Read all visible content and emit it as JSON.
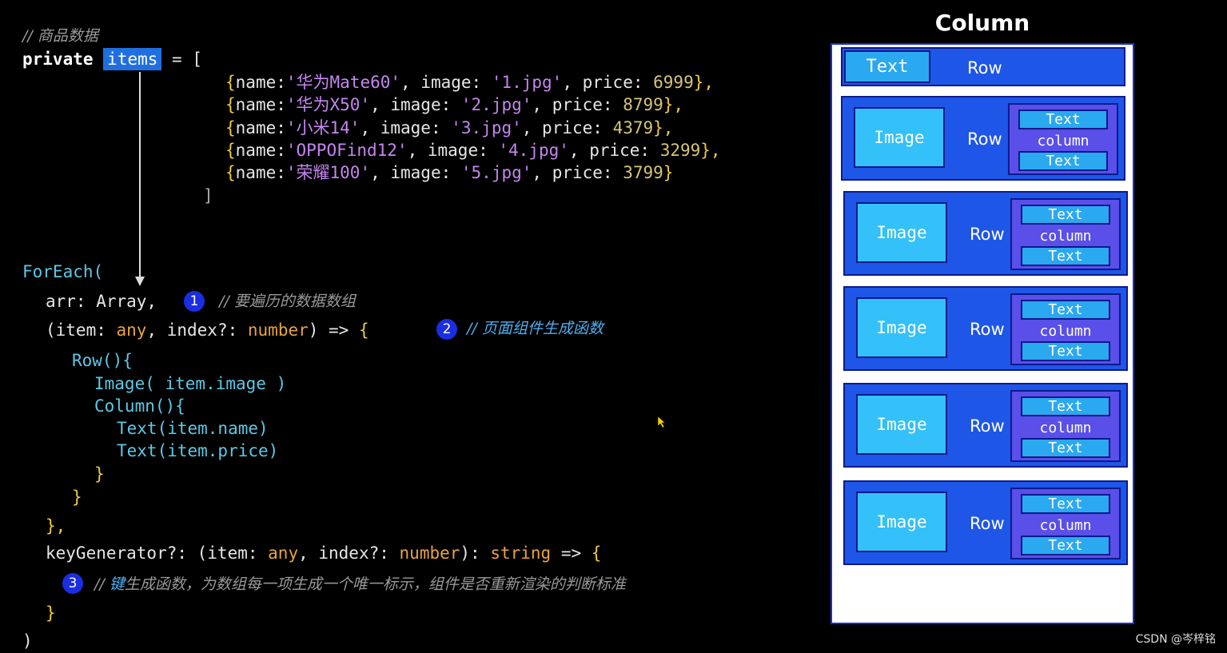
{
  "code": {
    "comment_top": "// 商品数据",
    "private_kw": "private",
    "items_name": "items",
    "assign": " = [",
    "entries": [
      {
        "name": "'华为Mate60'",
        "image": "'1.jpg'",
        "price": "6999",
        "end": "},"
      },
      {
        "name": "'华为X50'",
        "image": "'2.jpg'",
        "price": "8799",
        "end": "},"
      },
      {
        "name": "'小米14'",
        "image": "'3.jpg'",
        "price": "4379",
        "end": "},"
      },
      {
        "name": "'OPPOFind12'",
        "image": "'4.jpg'",
        "price": "3299",
        "end": "},"
      },
      {
        "name": "'荣耀100'",
        "image": "'5.jpg'",
        "price": "3799",
        "end": "}"
      }
    ],
    "close_bracket": "]",
    "foreach": "ForEach(",
    "arr_line": "arr: Array,",
    "arr_comment": "// 要遍历的数据数组",
    "item_line_a": "(item: ",
    "item_any": "any",
    "item_line_b": ", index?: ",
    "item_number": "number",
    "item_line_c": ") => ",
    "item_brace": "{",
    "item_comment": "// 页面组件生成函数",
    "row_open": "Row(){",
    "image_line": "Image( item.image )",
    "column_open": "Column(){",
    "text_name": "Text(item.name)",
    "text_price": "Text(item.price)",
    "close1": "}",
    "close2": "}",
    "close3": "},",
    "key_a": "keyGenerator?: (item: ",
    "key_any": "any",
    "key_b": ", index?: ",
    "key_number": "number",
    "key_c": "): ",
    "key_string": "string",
    "key_d": " => ",
    "key_brace": "{",
    "key_comment_hl": "键",
    "key_comment": "生成函数，为数组每一项生成一个唯一标示，组件是否重新渲染的判断标准",
    "key_comment_prefix": "// ",
    "close_key": "}",
    "close_paren": ")"
  },
  "badges": [
    "1",
    "2",
    "3"
  ],
  "diagram": {
    "title": "Column",
    "header_row": {
      "text": "Text",
      "row": "Row"
    },
    "rows": [
      {
        "image": "Image",
        "row": "Row",
        "col_top": "Text",
        "col_mid": "column",
        "col_bot": "Text"
      },
      {
        "image": "Image",
        "row": "Row",
        "col_top": "Text",
        "col_mid": "column",
        "col_bot": "Text"
      },
      {
        "image": "Image",
        "row": "Row",
        "col_top": "Text",
        "col_mid": "column",
        "col_bot": "Text"
      },
      {
        "image": "Image",
        "row": "Row",
        "col_top": "Text",
        "col_mid": "column",
        "col_bot": "Text"
      },
      {
        "image": "Image",
        "row": "Row",
        "col_top": "Text",
        "col_mid": "column",
        "col_bot": "Text"
      }
    ]
  },
  "watermark": "CSDN @岑梓铭",
  "colors": {
    "accent": "#1e56e8",
    "image": "#34c0f8",
    "column": "#5a4fe8"
  }
}
